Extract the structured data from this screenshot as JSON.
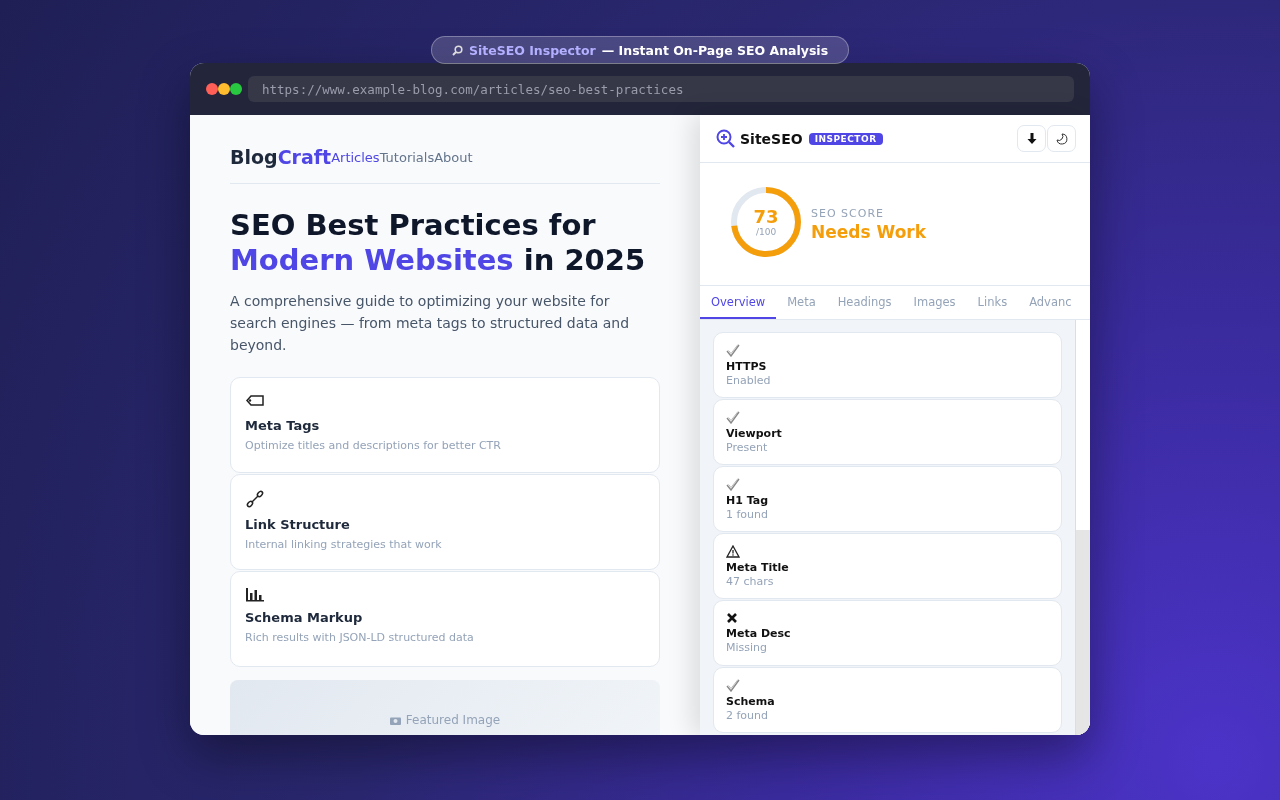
{
  "banner": {
    "brand": "SiteSEO Inspector",
    "tagline": "— Instant On-Page SEO Analysis"
  },
  "browser": {
    "url": "https://www.example-blog.com/articles/seo-best-practices"
  },
  "blog": {
    "logo": [
      "Blog",
      "Craft"
    ],
    "nav": [
      {
        "label": "Articles",
        "selected": true
      },
      {
        "label": "Tutorials",
        "selected": false
      },
      {
        "label": "About",
        "selected": false
      }
    ],
    "title": [
      {
        "text": "SEO Best Practices for ",
        "highlight": false
      },
      {
        "text": "Modern Websites",
        "highlight": true
      },
      {
        "text": " in 2025",
        "highlight": false
      }
    ],
    "description": "A comprehensive guide to optimizing your website for search engines — from meta tags to structured data and beyond.",
    "features": [
      {
        "kind": "tag",
        "title": "Meta Tags",
        "text": "Optimize titles and descriptions for better CTR"
      },
      {
        "kind": "link",
        "title": "Link Structure",
        "text": "Internal linking strategies that work"
      },
      {
        "kind": "chart",
        "title": "Schema Markup",
        "text": "Rich results with JSON-LD structured data"
      }
    ],
    "featured_image": {
      "label": "Featured Image"
    }
  },
  "panel": {
    "brand": "SiteSEO",
    "badge": "INSPECTOR",
    "score": {
      "value": "73",
      "max": "/100",
      "label": "SEO SCORE",
      "verdict": "Needs Work",
      "level": 0.73
    },
    "tabs": [
      {
        "label": "Overview",
        "selected": true
      },
      {
        "label": "Meta",
        "selected": false
      },
      {
        "label": "Headings",
        "selected": false
      },
      {
        "label": "Images",
        "selected": false
      },
      {
        "label": "Links",
        "selected": false
      },
      {
        "label": "Advanc",
        "selected": false
      }
    ],
    "checks": [
      {
        "kind": "pass",
        "name": "HTTPS",
        "detail": "Enabled"
      },
      {
        "kind": "pass",
        "name": "Viewport",
        "detail": "Present"
      },
      {
        "kind": "pass",
        "name": "H1 Tag",
        "detail": "1 found"
      },
      {
        "kind": "warn",
        "name": "Meta Title",
        "detail": "47 chars"
      },
      {
        "kind": "fail",
        "name": "Meta Desc",
        "detail": "Missing"
      },
      {
        "kind": "pass",
        "name": "Schema",
        "detail": "2 found"
      }
    ]
  }
}
